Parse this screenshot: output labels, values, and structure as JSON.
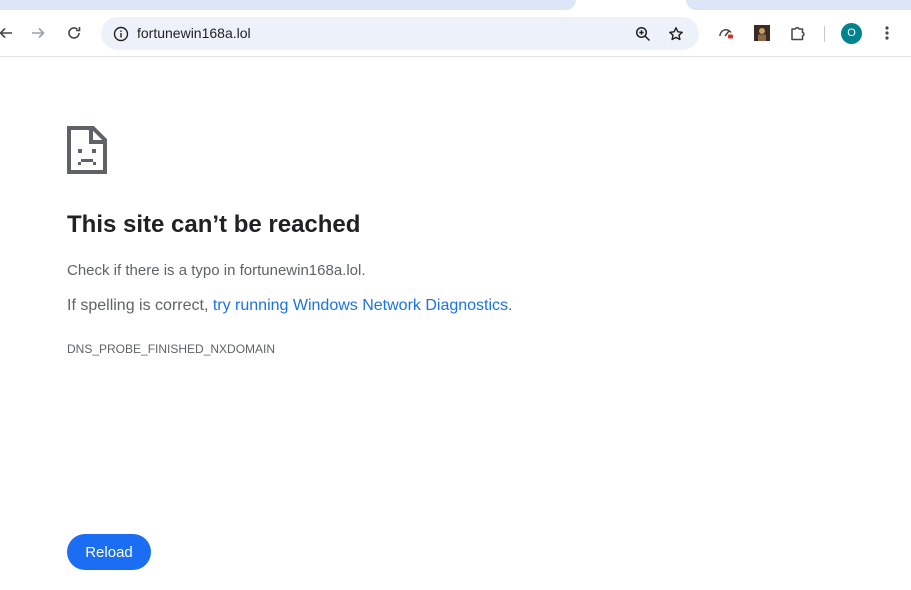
{
  "browser": {
    "url": "fortunewin168a.lol",
    "profile_initial": "O"
  },
  "error_page": {
    "title": "This site can’t be reached",
    "typo_message": "Check if there is a typo in fortunewin168a.lol.",
    "spelling_prefix": "If spelling is correct, ",
    "diagnostics_link": "try running Windows Network Diagnostics",
    "spelling_suffix": ".",
    "error_code": "DNS_PROBE_FINISHED_NXDOMAIN",
    "reload_label": "Reload"
  },
  "colors": {
    "accent": "#1b6ef3",
    "link": "#1a73e8",
    "profile": "#00838f",
    "omnibox": "#edf2fa"
  }
}
